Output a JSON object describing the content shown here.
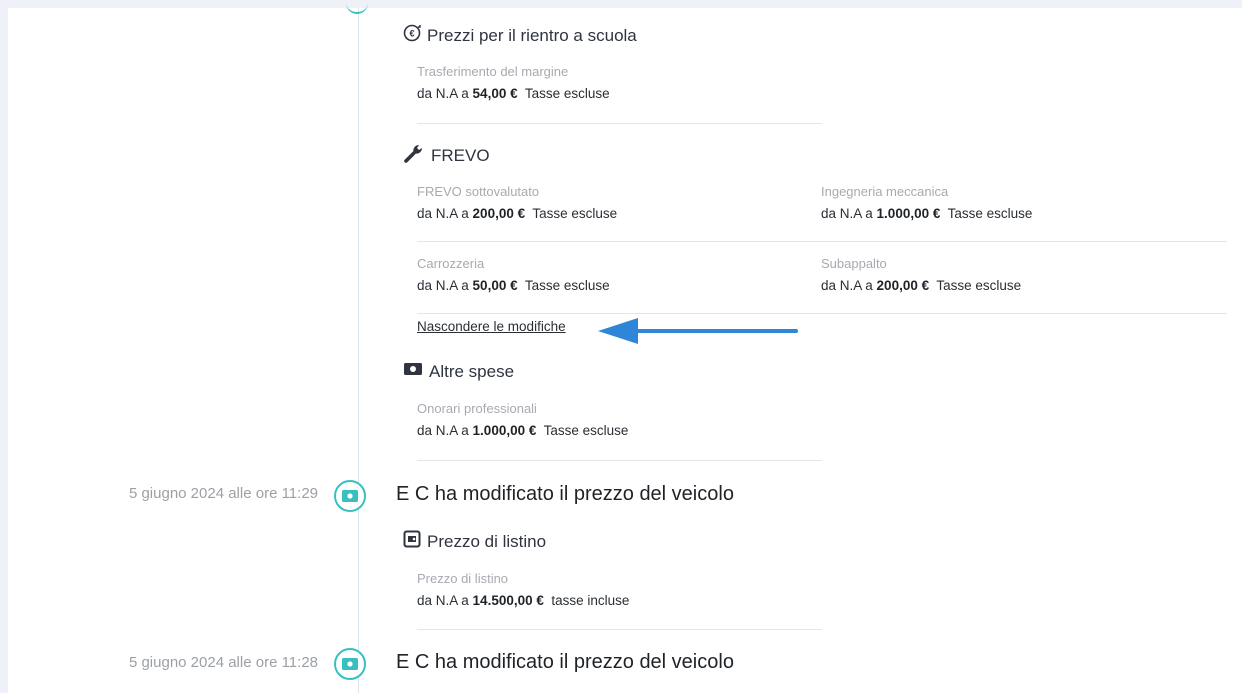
{
  "sections": {
    "back_to_school": {
      "title": "Prezzi per il rientro a scuola",
      "items": [
        {
          "label": "Trasferimento del margine",
          "from": "da N.A a ",
          "amount": "54,00 €",
          "tax": "Tasse escluse"
        }
      ]
    },
    "frevo": {
      "title": "FREVO",
      "items": [
        {
          "label": "FREVO sottovalutato",
          "from": "da N.A a ",
          "amount": "200,00 €",
          "tax": "Tasse escluse"
        },
        {
          "label": "Ingegneria meccanica",
          "from": "da N.A a ",
          "amount": "1.000,00 €",
          "tax": "Tasse escluse"
        },
        {
          "label": "Carrozzeria",
          "from": "da N.A a ",
          "amount": "50,00 €",
          "tax": "Tasse escluse"
        },
        {
          "label": "Subappalto",
          "from": "da N.A a ",
          "amount": "200,00 €",
          "tax": "Tasse escluse"
        }
      ],
      "hide_link": "Nascondere le modifiche"
    },
    "other_costs": {
      "title": "Altre spese",
      "items": [
        {
          "label": "Onorari professionali",
          "from": "da N.A a ",
          "amount": "1.000,00 €",
          "tax": "Tasse escluse"
        }
      ]
    },
    "list_price": {
      "title": "Prezzo di listino",
      "items": [
        {
          "label": "Prezzo di listino",
          "from": "da N.A a ",
          "amount": "14.500,00 €",
          "tax": "tasse incluse"
        }
      ]
    }
  },
  "events": [
    {
      "date": "5 giugno 2024 alle ore 11:29",
      "title": "E C ha modificato il prezzo del veicolo"
    },
    {
      "date": "5 giugno 2024 alle ore 11:28",
      "title": "E C ha modificato il prezzo del veicolo"
    }
  ],
  "colors": {
    "accent": "#37c0bf",
    "arrow": "#2f86d8"
  }
}
